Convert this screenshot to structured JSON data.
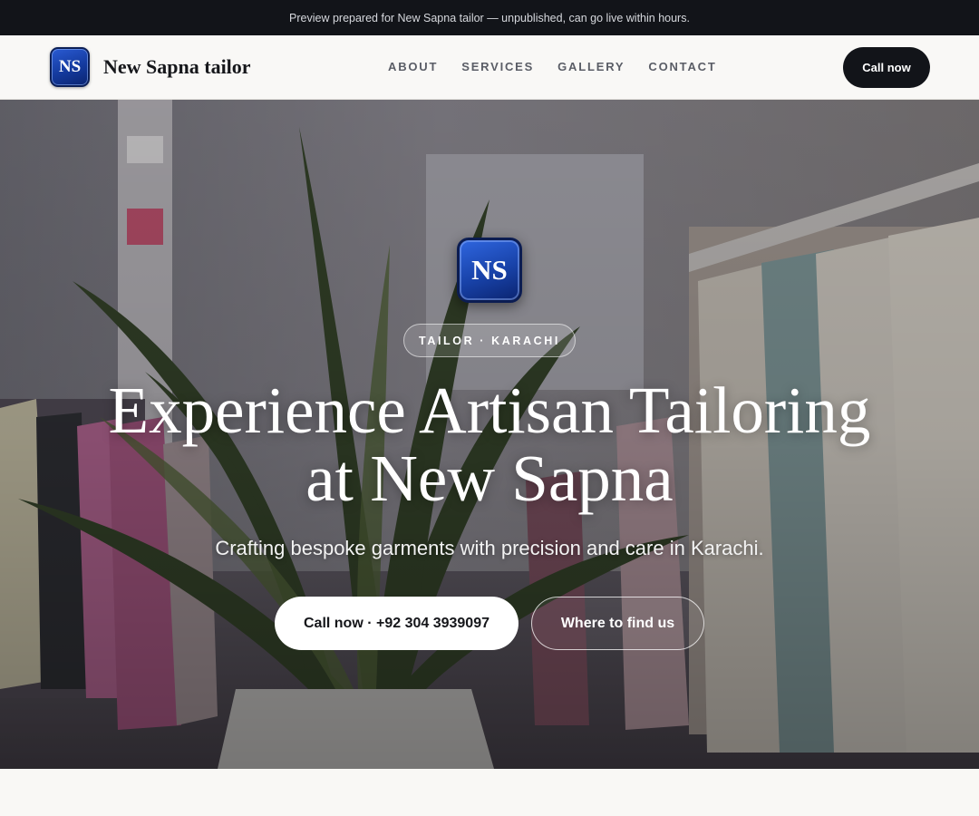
{
  "preview_banner": {
    "text": "Preview prepared for New Sapna tailor — unpublished, can go live within hours."
  },
  "header": {
    "logo_initials": "NS",
    "brand_name": "New Sapna tailor",
    "nav": [
      "ABOUT",
      "SERVICES",
      "GALLERY",
      "CONTACT"
    ],
    "cta_label": "Call now"
  },
  "hero": {
    "logo_initials": "NS",
    "tag": "TAILOR · KARACHI",
    "title_line1": "Experience Artisan Tailoring",
    "title_line2": "at New Sapna",
    "subtitle": "Crafting bespoke garments with precision and care in Karachi.",
    "primary_button": "Call now · +92 304 3939097",
    "secondary_button": "Where to find us",
    "background_image": "boutique-interior-photo"
  },
  "colors": {
    "topbar": "#121419",
    "accent_blue": "#1842a8",
    "cta_dark": "#121419",
    "page_bg": "#f8f7f4"
  }
}
